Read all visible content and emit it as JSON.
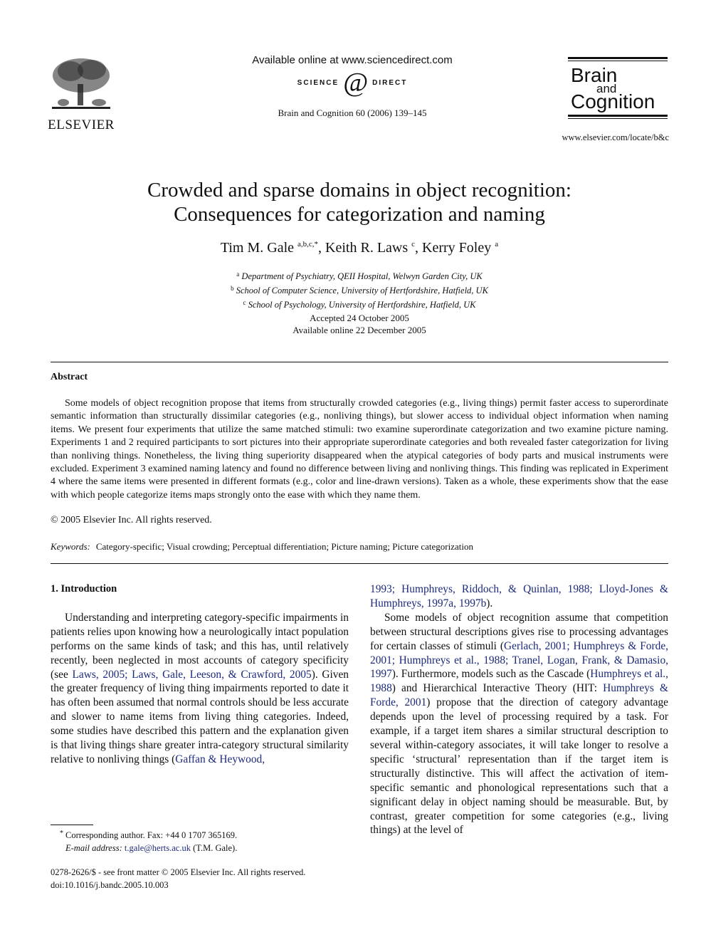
{
  "header": {
    "publisher_logo": "ELSEVIER",
    "available_online": "Available online at www.sciencedirect.com",
    "sciencedirect_logo": {
      "left": "SCIENCE",
      "mark": "@",
      "right": "DIRECT"
    },
    "journal_reference": "Brain and Cognition 60 (2006) 139–145",
    "journal_logo": {
      "line1": "Brain",
      "line2": "and",
      "line3": "Cognition"
    },
    "journal_url": "www.elsevier.com/locate/b&c"
  },
  "article": {
    "title_line1": "Crowded and sparse domains in object recognition:",
    "title_line2": "Consequences for categorization and naming",
    "authors": [
      {
        "name": "Tim M. Gale",
        "sup": "a,b,c,*",
        "sep": ", "
      },
      {
        "name": "Keith R. Laws",
        "sup": "c",
        "sep": ", "
      },
      {
        "name": "Kerry Foley",
        "sup": "a",
        "sep": ""
      }
    ],
    "affiliations": [
      {
        "sup": "a",
        "text": "Department of Psychiatry, QEII Hospital, Welwyn Garden City, UK"
      },
      {
        "sup": "b",
        "text": "School of Computer Science, University of Hertfordshire, Hatfield, UK"
      },
      {
        "sup": "c",
        "text": "School of Psychology, University of Hertfordshire, Hatfield, UK"
      }
    ],
    "accepted": "Accepted 24 October 2005",
    "available_online": "Available online 22 December 2005"
  },
  "abstract": {
    "heading": "Abstract",
    "text": "Some models of object recognition propose that items from structurally crowded categories (e.g., living things) permit faster access to superordinate semantic information than structurally dissimilar categories (e.g., nonliving things), but slower access to individual object information when naming items. We present four experiments that utilize the same matched stimuli: two examine superordinate categorization and two examine picture naming. Experiments 1 and 2 required participants to sort pictures into their appropriate superordinate categories and both revealed faster categorization for living than nonliving things. Nonetheless, the living thing superiority disappeared when the atypical categories of body parts and musical instruments were excluded. Experiment 3 examined naming latency and found no difference between living and nonliving things. This finding was replicated in Experiment 4 where the same items were presented in different formats (e.g., color and line-drawn versions). Taken as a whole, these experiments show that the ease with which people categorize items maps strongly onto the ease with which they name them.",
    "copyright": "© 2005 Elsevier Inc. All rights reserved.",
    "keywords_label": "Keywords:",
    "keywords": "Category-specific; Visual crowding; Perceptual differentiation; Picture naming; Picture categorization"
  },
  "body": {
    "section_heading": "1. Introduction",
    "left": {
      "p1_a": "Understanding and interpreting category-specific impairments in patients relies upon knowing how a neurologically intact population performs on the same kinds of task; and this has, until relatively recently, been neglected in most accounts of category specificity (see ",
      "p1_cite": "Laws, 2005; Laws, Gale, Leeson, & Crawford, 2005",
      "p1_b": "). Given the greater frequency of living thing impairments reported to date it has often been assumed that normal controls should be less accurate and slower to name items from living thing categories. Indeed, some studies have described this pattern and the explanation given is that living things share greater intra-category structural similarity relative to nonliving things (",
      "p1_cite2": "Gaffan & Heywood,"
    },
    "right": {
      "cont_cite": "1993; Humphreys, Riddoch, & Quinlan, 1988; Lloyd-Jones & Humphreys, 1997a, 1997b",
      "cont_end": ").",
      "p2_a": "Some models of object recognition assume that competition between structural descriptions gives rise to processing advantages for certain classes of stimuli (",
      "p2_cite1": "Gerlach, 2001; Humphreys & Forde, 2001; Humphreys et al., 1988; Tranel, Logan, Frank, & Damasio, 1997",
      "p2_b": "). Furthermore, models such as the Cascade (",
      "p2_cite2": "Humphreys et al., 1988",
      "p2_c": ") and Hierarchical Interactive Theory (HIT: ",
      "p2_cite3": "Humphreys & Forde, 2001",
      "p2_d": ") propose that the direction of category advantage depends upon the level of processing required by a task. For example, if a target item shares a similar structural description to several within-category associates, it will take longer to resolve a specific ‘structural’ representation than if the target item is structurally distinctive. This will affect the activation of item-specific semantic and phonological representations such that a significant delay in object naming should be measurable. But, by contrast, greater competition for some categories (e.g., living things) at the level of"
    }
  },
  "footnotes": {
    "star": "*",
    "corresponding": "Corresponding author. Fax: +44 0 1707 365169.",
    "email_label": "E-mail address:",
    "email": "t.gale@herts.ac.uk",
    "email_suffix": " (T.M. Gale).",
    "front_matter": "0278-2626/$ - see front matter © 2005 Elsevier Inc. All rights reserved.",
    "doi": "doi:10.1016/j.bandc.2005.10.003"
  }
}
